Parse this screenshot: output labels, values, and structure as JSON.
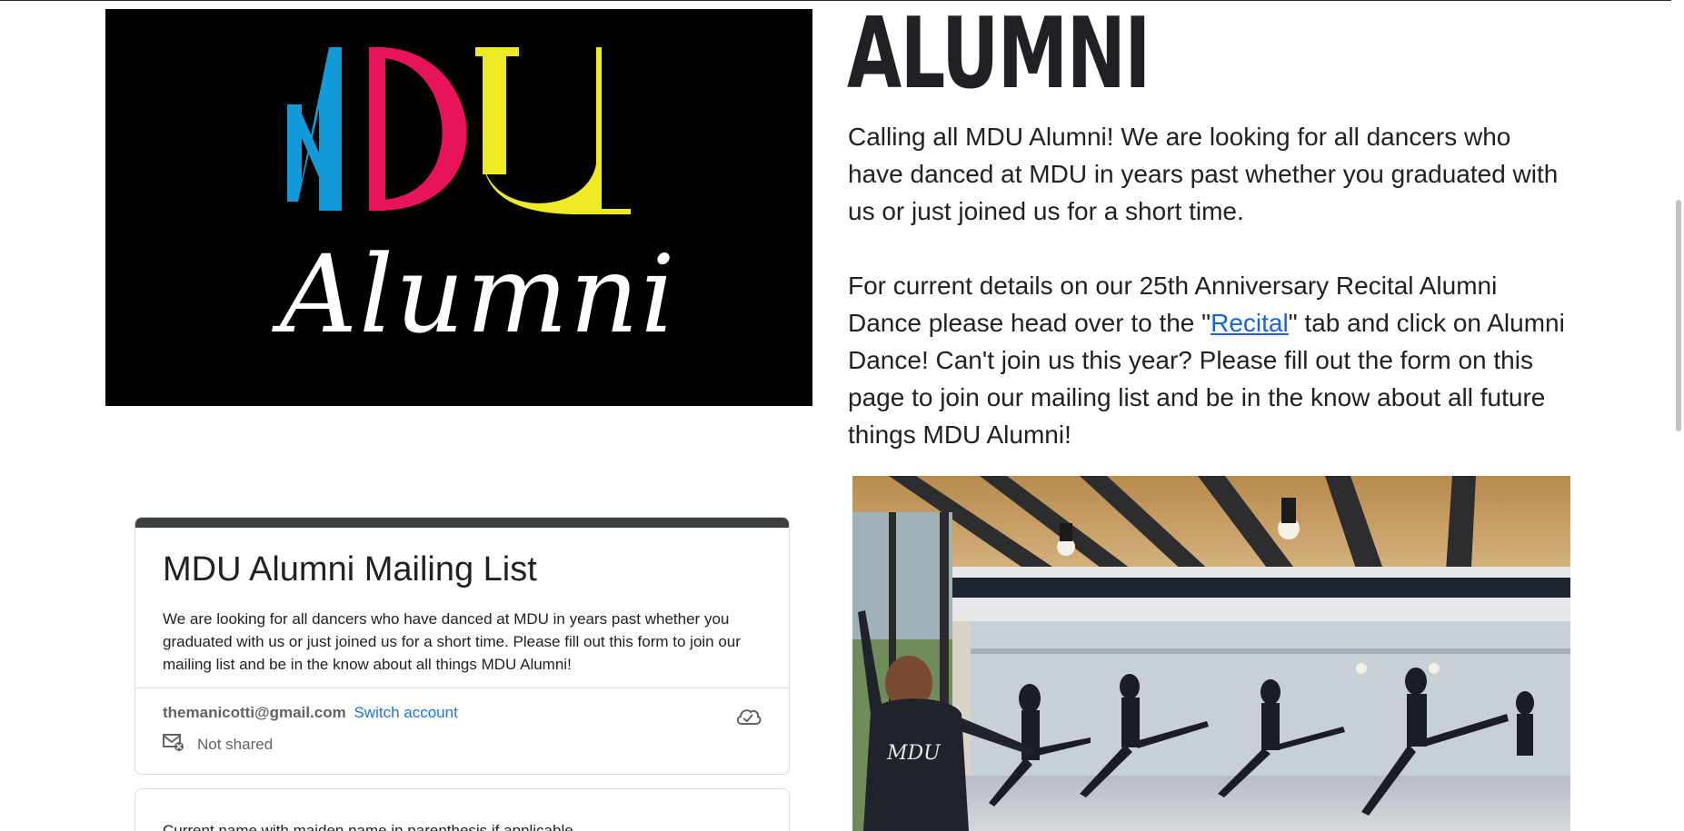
{
  "logo": {
    "letters": "MDU",
    "script_text": "Alumni",
    "colors": {
      "m": "#129ad8",
      "d": "#e8145a",
      "u": "#eeea25",
      "script": "#ffffff",
      "background": "#000000"
    }
  },
  "heading": "ALUMNI",
  "intro": {
    "paragraph1": "Calling all MDU Alumni! We are looking for all dancers who have danced at MDU in years past whether you graduated with us or just joined us for a short time.",
    "paragraph2_before": "For current details on our 25th Anniversary Recital Alumni Dance please head over to the \"",
    "paragraph2_link": "Recital",
    "paragraph2_after": "\" tab and click on Alumni Dance! Can't join us this year? Please fill out the form on this page to join our mailing list and be in the know about all future things MDU Alumni!"
  },
  "photo": {
    "hoodie_text": "MDU"
  },
  "form": {
    "title": "MDU Alumni Mailing List",
    "description": "We are looking for all dancers who have danced at MDU in years past whether you graduated with us or just joined us for a short time.  Please fill out this form to join our mailing list and be in the know about all things MDU Alumni!",
    "account_email": "themanicotti@gmail.com",
    "switch_account": "Switch account",
    "not_shared": "Not shared",
    "first_question": "Current name with maiden name in parenthesis if applicable"
  },
  "colors": {
    "link": "#1a63d6",
    "form_link": "#1a73e8",
    "form_header_bar": "#3c4043",
    "text": "#202124"
  }
}
